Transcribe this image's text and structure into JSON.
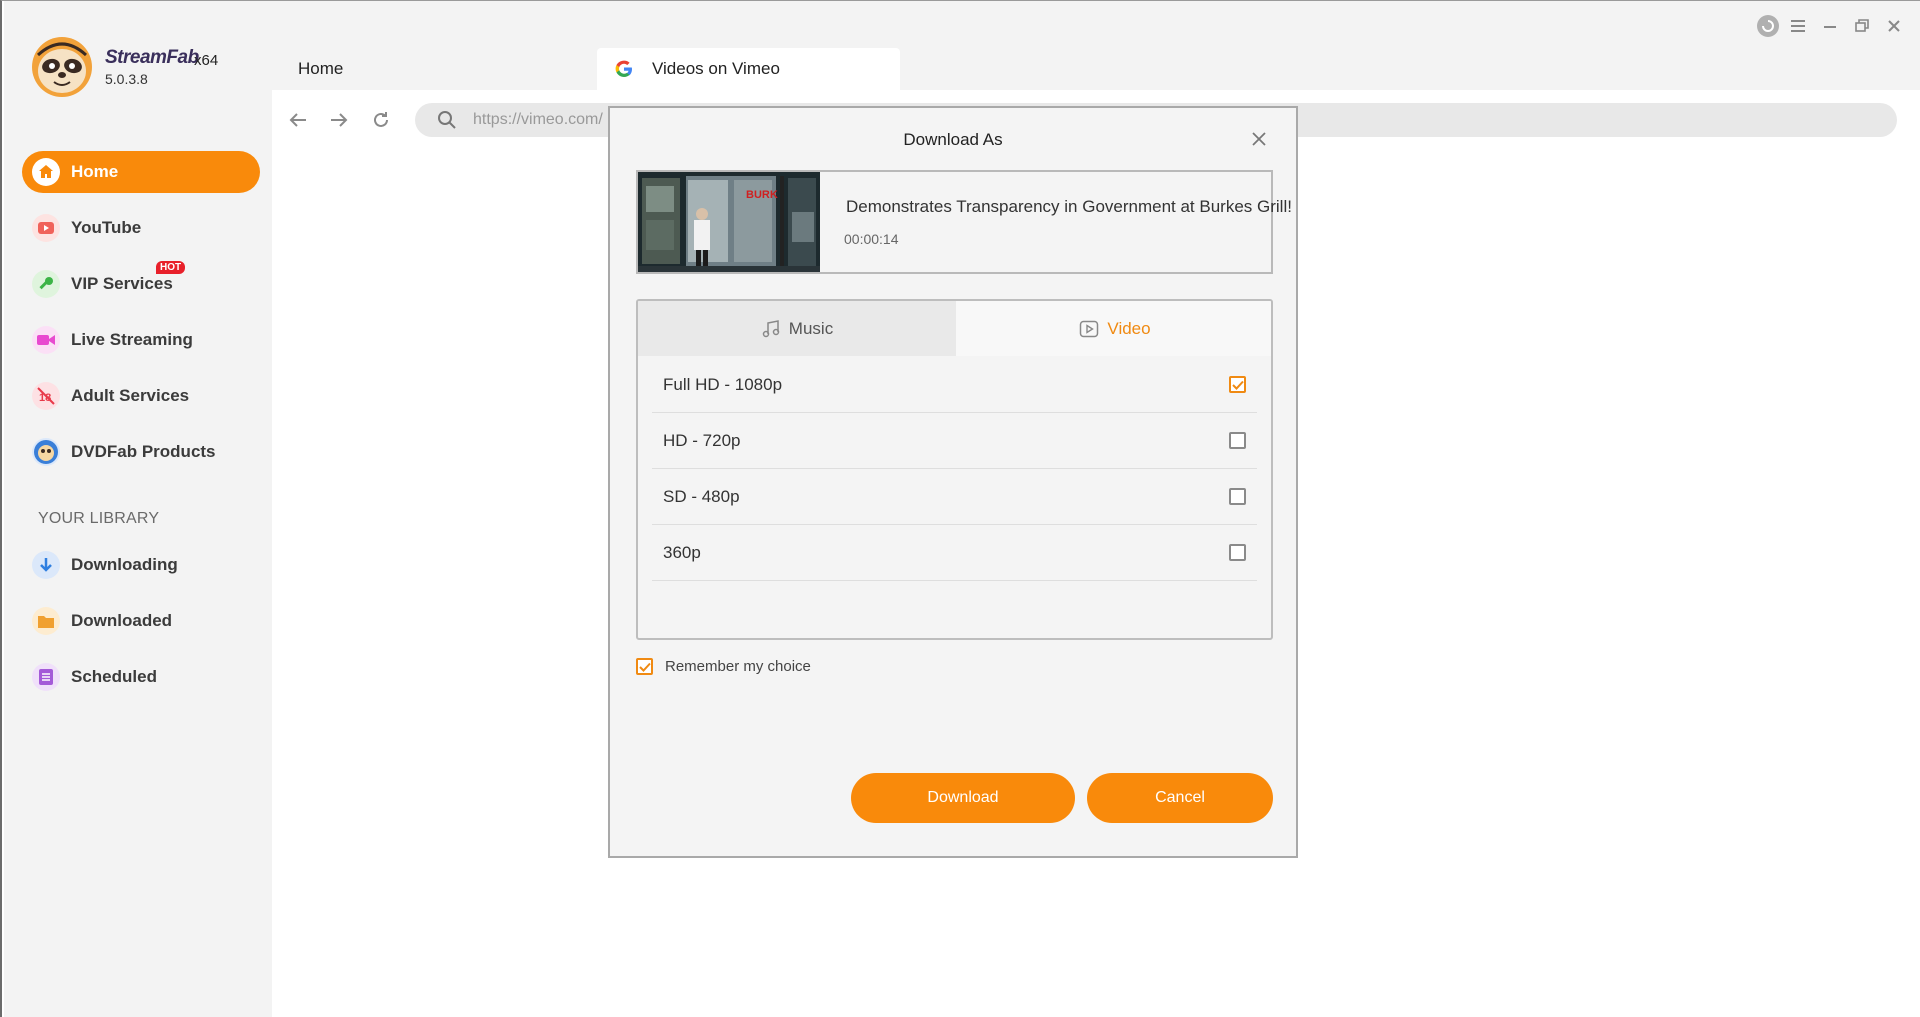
{
  "app": {
    "name": "StreamFab",
    "arch": "x64",
    "version": "5.0.3.8"
  },
  "sidebar": {
    "items": [
      {
        "label": "Home",
        "icon": "home-icon",
        "color": "#f98a0b"
      },
      {
        "label": "YouTube",
        "icon": "youtube-icon",
        "color": "#f0625a"
      },
      {
        "label": "VIP Services",
        "icon": "key-icon",
        "color": "#4ec24a",
        "badge": "HOT"
      },
      {
        "label": "Live Streaming",
        "icon": "camera-icon",
        "color": "#e84ad0"
      },
      {
        "label": "Adult Services",
        "icon": "no-18-icon",
        "color": "#e83a4a"
      },
      {
        "label": "DVDFab Products",
        "icon": "dvdfab-icon",
        "color": "#3a7fd8"
      }
    ],
    "library_title": "YOUR LIBRARY",
    "library": [
      {
        "label": "Downloading",
        "icon": "download-arrow-icon",
        "color": "#2f7fe0"
      },
      {
        "label": "Downloaded",
        "icon": "folder-icon",
        "color": "#f0a030"
      },
      {
        "label": "Scheduled",
        "icon": "list-icon",
        "color": "#a45ad8"
      }
    ]
  },
  "tabs": {
    "home": "Home",
    "active": "Videos on Vimeo"
  },
  "navbar": {
    "url": "https://vimeo.com/"
  },
  "dialog": {
    "title": "Download As",
    "video_title": "Demonstrates Transparency in Government at Burkes Grill!",
    "duration": "00:00:14",
    "tab_music": "Music",
    "tab_video": "Video",
    "qualities": [
      {
        "label": "Full HD - 1080p",
        "checked": true
      },
      {
        "label": "HD - 720p",
        "checked": false
      },
      {
        "label": "SD - 480p",
        "checked": false
      },
      {
        "label": "360p",
        "checked": false
      }
    ],
    "remember_label": "Remember my choice",
    "remember_checked": true,
    "download_label": "Download",
    "cancel_label": "Cancel"
  },
  "colors": {
    "accent": "#f98a0b",
    "sidebar_bg": "#f3f3f3"
  }
}
